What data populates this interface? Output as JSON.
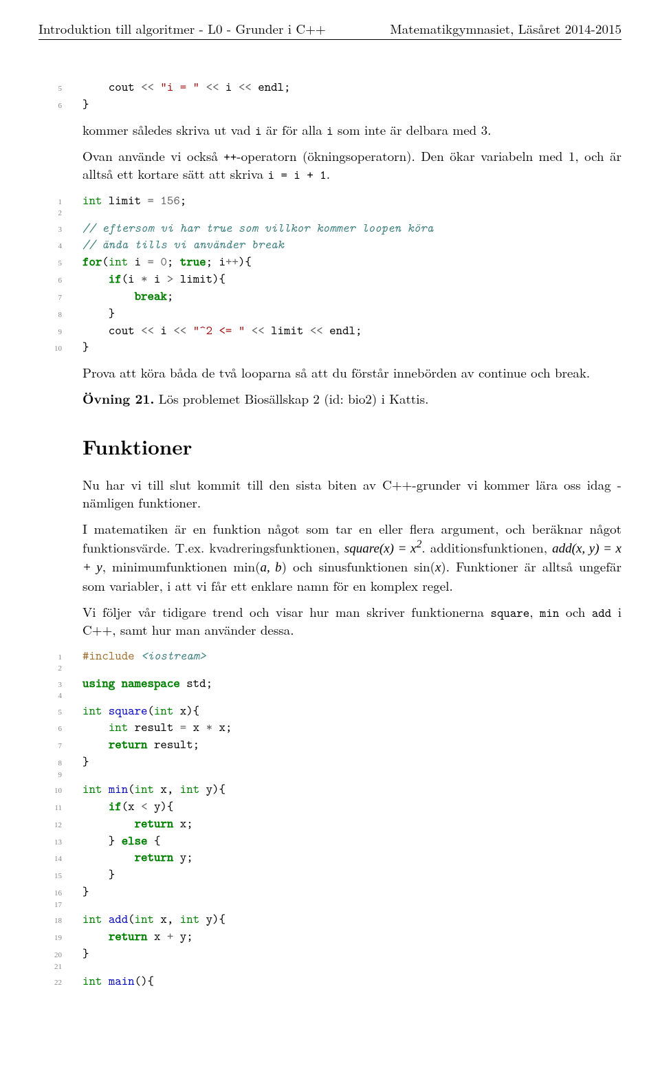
{
  "header": {
    "left": "Introduktion till algoritmer - L0 - Grunder i C++",
    "right": "Matematikgymnasiet, Läsåret 2014-2015"
  },
  "code1": {
    "lines": [
      {
        "n": "5",
        "tokens": [
          {
            "t": "    cout ",
            "c": ""
          },
          {
            "t": "<<",
            "c": "op"
          },
          {
            "t": " ",
            "c": ""
          },
          {
            "t": "\"i = \"",
            "c": "str"
          },
          {
            "t": " ",
            "c": ""
          },
          {
            "t": "<<",
            "c": "op"
          },
          {
            "t": " i ",
            "c": ""
          },
          {
            "t": "<<",
            "c": "op"
          },
          {
            "t": " endl;",
            "c": ""
          }
        ]
      },
      {
        "n": "6",
        "tokens": [
          {
            "t": "}",
            "c": ""
          }
        ]
      }
    ]
  },
  "para1_pre": "kommer således skriva ut vad ",
  "para1_tt1": "i",
  "para1_mid": " är för alla ",
  "para1_tt2": "i",
  "para1_post": " som inte är delbara med 3.",
  "para2_a": "Ovan använde vi också ",
  "para2_tt1": "++",
  "para2_b": "-operatorn (ökningsoperatorn). Den ökar variabeln med 1, och är alltså ett kortare sätt att skriva ",
  "para2_tt2": "i = i + 1",
  "para2_c": ".",
  "code2": {
    "lines": [
      {
        "n": "1",
        "tokens": [
          {
            "t": "int",
            "c": "typ"
          },
          {
            "t": " limit ",
            "c": ""
          },
          {
            "t": "=",
            "c": "op"
          },
          {
            "t": " ",
            "c": ""
          },
          {
            "t": "156",
            "c": "num"
          },
          {
            "t": ";",
            "c": ""
          }
        ]
      },
      {
        "n": "2",
        "tokens": [
          {
            "t": "",
            "c": ""
          }
        ]
      },
      {
        "n": "3",
        "tokens": [
          {
            "t": "// eftersom vi har true som villkor kommer loopen köra",
            "c": "cm"
          }
        ]
      },
      {
        "n": "4",
        "tokens": [
          {
            "t": "// ända tills vi använder break",
            "c": "cm"
          }
        ]
      },
      {
        "n": "5",
        "tokens": [
          {
            "t": "for",
            "c": "kw"
          },
          {
            "t": "(",
            "c": ""
          },
          {
            "t": "int",
            "c": "typ"
          },
          {
            "t": " i ",
            "c": ""
          },
          {
            "t": "=",
            "c": "op"
          },
          {
            "t": " ",
            "c": ""
          },
          {
            "t": "0",
            "c": "num"
          },
          {
            "t": "; ",
            "c": ""
          },
          {
            "t": "true",
            "c": "kw"
          },
          {
            "t": "; i",
            "c": ""
          },
          {
            "t": "++",
            "c": "op"
          },
          {
            "t": "){",
            "c": ""
          }
        ]
      },
      {
        "n": "6",
        "tokens": [
          {
            "t": "    ",
            "c": ""
          },
          {
            "t": "if",
            "c": "kw"
          },
          {
            "t": "(i ",
            "c": ""
          },
          {
            "t": "*",
            "c": "op"
          },
          {
            "t": " i ",
            "c": ""
          },
          {
            "t": ">",
            "c": "op"
          },
          {
            "t": " limit){",
            "c": ""
          }
        ]
      },
      {
        "n": "7",
        "tokens": [
          {
            "t": "        ",
            "c": ""
          },
          {
            "t": "break",
            "c": "kw"
          },
          {
            "t": ";",
            "c": ""
          }
        ]
      },
      {
        "n": "8",
        "tokens": [
          {
            "t": "    }",
            "c": ""
          }
        ]
      },
      {
        "n": "9",
        "tokens": [
          {
            "t": "    cout ",
            "c": ""
          },
          {
            "t": "<<",
            "c": "op"
          },
          {
            "t": " i ",
            "c": ""
          },
          {
            "t": "<<",
            "c": "op"
          },
          {
            "t": " ",
            "c": ""
          },
          {
            "t": "\"^2 <= \"",
            "c": "str"
          },
          {
            "t": " ",
            "c": ""
          },
          {
            "t": "<<",
            "c": "op"
          },
          {
            "t": " limit ",
            "c": ""
          },
          {
            "t": "<<",
            "c": "op"
          },
          {
            "t": " endl;",
            "c": ""
          }
        ]
      },
      {
        "n": "10",
        "tokens": [
          {
            "t": "}",
            "c": ""
          }
        ]
      }
    ]
  },
  "para3": "Prova att köra båda de två looparna så att du förstår innebörden av continue och break.",
  "ex21_label": "Övning 21.",
  "ex21_text": " Lös problemet Biosällskap 2 (id: bio2) i Kattis.",
  "section": "Funktioner",
  "para4": "Nu har vi till slut kommit till den sista biten av C++-grunder vi kommer lära oss idag - nämligen funktioner.",
  "para5_a": "I matematiken är en funktion något som tar en eller flera argument, och beräknar något funktionsvärde. T.ex. kvadreringsfunktionen, ",
  "para5_m1": "square(x) = x",
  "para5_sup1": "2",
  "para5_b": ". additionsfunktionen, ",
  "para5_m2": "add(x, y) = x + y",
  "para5_c": ", minimumfunktionen ",
  "para5_m3": "min(a, b)",
  "para5_d": " och sinusfunktionen ",
  "para5_m4": "sin(x)",
  "para5_e": ". Funktioner är alltså ungefär som variabler, i att vi får ett enklare namn för en komplex regel.",
  "para6_a": "Vi följer vår tidigare trend och visar hur man skriver funktionerna ",
  "para6_tt1": "square",
  "para6_b": ", ",
  "para6_tt2": "min",
  "para6_c": " och ",
  "para6_tt3": "add",
  "para6_d": " i C++, samt hur man använder dessa.",
  "code3": {
    "lines": [
      {
        "n": "1",
        "tokens": [
          {
            "t": "#include ",
            "c": "pp"
          },
          {
            "t": "<iostream>",
            "c": "ppfile"
          }
        ]
      },
      {
        "n": "2",
        "tokens": [
          {
            "t": "",
            "c": ""
          }
        ]
      },
      {
        "n": "3",
        "tokens": [
          {
            "t": "using",
            "c": "kw"
          },
          {
            "t": " ",
            "c": ""
          },
          {
            "t": "namespace",
            "c": "kw"
          },
          {
            "t": " std;",
            "c": ""
          }
        ]
      },
      {
        "n": "4",
        "tokens": [
          {
            "t": "",
            "c": ""
          }
        ]
      },
      {
        "n": "5",
        "tokens": [
          {
            "t": "int",
            "c": "typ"
          },
          {
            "t": " ",
            "c": ""
          },
          {
            "t": "square",
            "c": "fn"
          },
          {
            "t": "(",
            "c": ""
          },
          {
            "t": "int",
            "c": "typ"
          },
          {
            "t": " x){",
            "c": ""
          }
        ]
      },
      {
        "n": "6",
        "tokens": [
          {
            "t": "    ",
            "c": ""
          },
          {
            "t": "int",
            "c": "typ"
          },
          {
            "t": " result ",
            "c": ""
          },
          {
            "t": "=",
            "c": "op"
          },
          {
            "t": " x ",
            "c": ""
          },
          {
            "t": "*",
            "c": "op"
          },
          {
            "t": " x;",
            "c": ""
          }
        ]
      },
      {
        "n": "7",
        "tokens": [
          {
            "t": "    ",
            "c": ""
          },
          {
            "t": "return",
            "c": "kw"
          },
          {
            "t": " result;",
            "c": ""
          }
        ]
      },
      {
        "n": "8",
        "tokens": [
          {
            "t": "}",
            "c": ""
          }
        ]
      },
      {
        "n": "9",
        "tokens": [
          {
            "t": "",
            "c": ""
          }
        ]
      },
      {
        "n": "10",
        "tokens": [
          {
            "t": "int",
            "c": "typ"
          },
          {
            "t": " ",
            "c": ""
          },
          {
            "t": "min",
            "c": "fn"
          },
          {
            "t": "(",
            "c": ""
          },
          {
            "t": "int",
            "c": "typ"
          },
          {
            "t": " x, ",
            "c": ""
          },
          {
            "t": "int",
            "c": "typ"
          },
          {
            "t": " y){",
            "c": ""
          }
        ]
      },
      {
        "n": "11",
        "tokens": [
          {
            "t": "    ",
            "c": ""
          },
          {
            "t": "if",
            "c": "kw"
          },
          {
            "t": "(x ",
            "c": ""
          },
          {
            "t": "<",
            "c": "op"
          },
          {
            "t": " y){",
            "c": ""
          }
        ]
      },
      {
        "n": "12",
        "tokens": [
          {
            "t": "        ",
            "c": ""
          },
          {
            "t": "return",
            "c": "kw"
          },
          {
            "t": " x;",
            "c": ""
          }
        ]
      },
      {
        "n": "13",
        "tokens": [
          {
            "t": "    } ",
            "c": ""
          },
          {
            "t": "else",
            "c": "kw"
          },
          {
            "t": " {",
            "c": ""
          }
        ]
      },
      {
        "n": "14",
        "tokens": [
          {
            "t": "        ",
            "c": ""
          },
          {
            "t": "return",
            "c": "kw"
          },
          {
            "t": " y;",
            "c": ""
          }
        ]
      },
      {
        "n": "15",
        "tokens": [
          {
            "t": "    }",
            "c": ""
          }
        ]
      },
      {
        "n": "16",
        "tokens": [
          {
            "t": "}",
            "c": ""
          }
        ]
      },
      {
        "n": "17",
        "tokens": [
          {
            "t": "",
            "c": ""
          }
        ]
      },
      {
        "n": "18",
        "tokens": [
          {
            "t": "int",
            "c": "typ"
          },
          {
            "t": " ",
            "c": ""
          },
          {
            "t": "add",
            "c": "fn"
          },
          {
            "t": "(",
            "c": ""
          },
          {
            "t": "int",
            "c": "typ"
          },
          {
            "t": " x, ",
            "c": ""
          },
          {
            "t": "int",
            "c": "typ"
          },
          {
            "t": " y){",
            "c": ""
          }
        ]
      },
      {
        "n": "19",
        "tokens": [
          {
            "t": "    ",
            "c": ""
          },
          {
            "t": "return",
            "c": "kw"
          },
          {
            "t": " x ",
            "c": ""
          },
          {
            "t": "+",
            "c": "op"
          },
          {
            "t": " y;",
            "c": ""
          }
        ]
      },
      {
        "n": "20",
        "tokens": [
          {
            "t": "}",
            "c": ""
          }
        ]
      },
      {
        "n": "21",
        "tokens": [
          {
            "t": "",
            "c": ""
          }
        ]
      },
      {
        "n": "22",
        "tokens": [
          {
            "t": "int",
            "c": "typ"
          },
          {
            "t": " ",
            "c": ""
          },
          {
            "t": "main",
            "c": "fn"
          },
          {
            "t": "(){",
            "c": ""
          }
        ]
      }
    ]
  }
}
